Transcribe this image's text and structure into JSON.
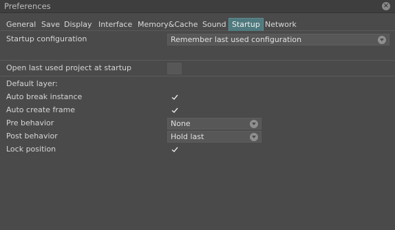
{
  "window": {
    "title": "Preferences"
  },
  "tabs": [
    {
      "label": "General"
    },
    {
      "label": "Save"
    },
    {
      "label": "Display"
    },
    {
      "label": "Interface"
    },
    {
      "label": "Memory&Cache"
    },
    {
      "label": "Sound"
    },
    {
      "label": "Startup",
      "active": true
    },
    {
      "label": "Network"
    }
  ],
  "startup": {
    "configuration_label": "Startup configuration",
    "configuration_value": "Remember last used configuration",
    "open_last_project_label": "Open last used project at startup",
    "open_last_project_checked": false
  },
  "default_layer": {
    "heading": "Default layer:",
    "auto_break_instance_label": "Auto break instance",
    "auto_break_instance_checked": true,
    "auto_create_frame_label": "Auto create frame",
    "auto_create_frame_checked": true,
    "pre_behavior_label": "Pre behavior",
    "pre_behavior_value": "None",
    "post_behavior_label": "Post behavior",
    "post_behavior_value": "Hold last",
    "lock_position_label": "Lock position",
    "lock_position_checked": true
  },
  "icons": {
    "close": "close-icon",
    "dropdown": "chevron-down-icon",
    "check": "checkmark-icon"
  },
  "colors": {
    "active_tab": "#4f7a7f",
    "background": "#4a4a4a"
  }
}
